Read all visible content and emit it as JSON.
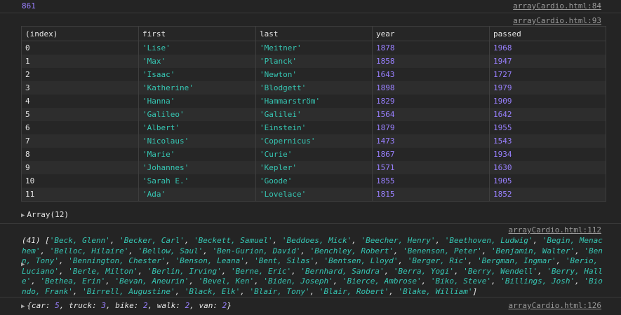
{
  "top_value": "861",
  "top_source": "arrayCardio.html:84",
  "table_source": "arrayCardio.html:93",
  "table": {
    "columns": [
      "(index)",
      "first",
      "last",
      "year",
      "passed"
    ],
    "rows": [
      [
        "0",
        "'Lise'",
        "'Meitner'",
        "1878",
        "1968"
      ],
      [
        "1",
        "'Max'",
        "'Planck'",
        "1858",
        "1947"
      ],
      [
        "2",
        "'Isaac'",
        "'Newton'",
        "1643",
        "1727"
      ],
      [
        "3",
        "'Katherine'",
        "'Blodgett'",
        "1898",
        "1979"
      ],
      [
        "4",
        "'Hanna'",
        "'Hammarström'",
        "1829",
        "1909"
      ],
      [
        "5",
        "'Galileo'",
        "'Galilei'",
        "1564",
        "1642"
      ],
      [
        "6",
        "'Albert'",
        "'Einstein'",
        "1879",
        "1955"
      ],
      [
        "7",
        "'Nicolaus'",
        "'Copernicus'",
        "1473",
        "1543"
      ],
      [
        "8",
        "'Marie'",
        "'Curie'",
        "1867",
        "1934"
      ],
      [
        "9",
        "'Johannes'",
        "'Kepler'",
        "1571",
        "1630"
      ],
      [
        "10",
        "'Sarah E.'",
        "'Goode'",
        "1855",
        "1905"
      ],
      [
        "11",
        "'Ada'",
        "'Lovelace'",
        "1815",
        "1852"
      ]
    ]
  },
  "array_summary": "Array(12)",
  "names_source": "arrayCardio.html:112",
  "names_count": "(41)",
  "names": [
    "Beck, Glenn",
    "Becker, Carl",
    "Beckett, Samuel",
    "Beddoes, Mick",
    "Beecher, Henry",
    "Beethoven, Ludwig",
    "Begin, Menachem",
    "Belloc, Hilaire",
    "Bellow, Saul",
    "Ben-Gurion, David",
    "Benchley, Robert",
    "Benenson, Peter",
    "Benjamin, Walter",
    "Benn, Tony",
    "Bennington, Chester",
    "Benson, Leana",
    "Bent, Silas",
    "Bentsen, Lloyd",
    "Berger, Ric",
    "Bergman, Ingmar",
    "Berio, Luciano",
    "Berle, Milton",
    "Berlin, Irving",
    "Berne, Eric",
    "Bernhard, Sandra",
    "Berra, Yogi",
    "Berry, Wendell",
    "Berry, Halle",
    "Bethea, Erin",
    "Bevan, Aneurin",
    "Bevel, Ken",
    "Biden, Joseph",
    "Bierce, Ambrose",
    "Biko, Steve",
    "Billings, Josh",
    "Biondo, Frank",
    "Birrell, Augustine",
    "Black, Elk",
    "Blair, Tony",
    "Blair, Robert",
    "Blake, William"
  ],
  "object_source": "arrayCardio.html:126",
  "object_entries": [
    {
      "key": "car",
      "value": "5"
    },
    {
      "key": "truck",
      "value": "3"
    },
    {
      "key": "bike",
      "value": "2"
    },
    {
      "key": "walk",
      "value": "2"
    },
    {
      "key": "van",
      "value": "2"
    }
  ]
}
